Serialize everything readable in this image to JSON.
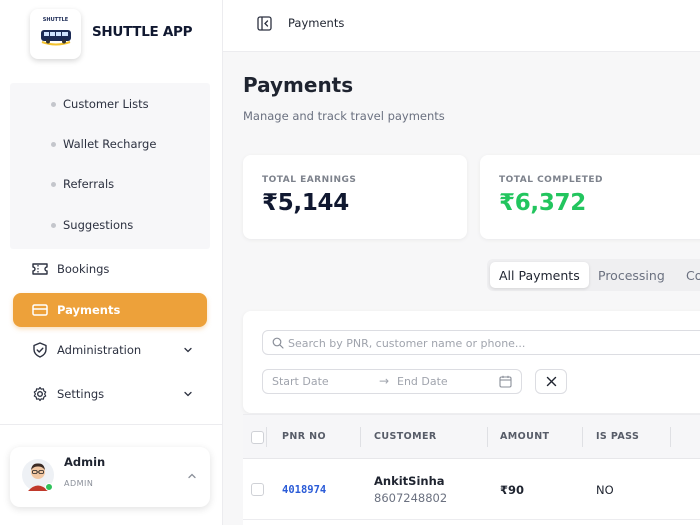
{
  "brand": {
    "name": "SHUTTLE APP",
    "logo_text": "SHUTTLE",
    "logo_bus_color": "#1b2a55",
    "logo_accent_color": "#f2c230"
  },
  "sidebar": {
    "submenu": [
      {
        "label": "Customer Lists"
      },
      {
        "label": "Wallet Recharge"
      },
      {
        "label": "Referrals"
      },
      {
        "label": "Suggestions"
      }
    ],
    "nav": {
      "bookings": {
        "label": "Bookings",
        "icon": "ticket-icon"
      },
      "payments": {
        "label": "Payments",
        "icon": "card-icon",
        "active": true
      },
      "administration": {
        "label": "Administration",
        "icon": "shield-icon"
      },
      "settings": {
        "label": "Settings",
        "icon": "gear-icon"
      }
    },
    "user": {
      "name": "Admin",
      "role": "ADMIN",
      "status_color": "#2fc25b"
    }
  },
  "topbar": {
    "breadcrumb": "Payments"
  },
  "page": {
    "title": "Payments",
    "subtitle": "Manage and track travel payments"
  },
  "stats": [
    {
      "label": "TOTAL EARNINGS",
      "value": "₹5,144",
      "color": "#101830"
    },
    {
      "label": "TOTAL COMPLETED",
      "value": "₹6,372",
      "color": "#22c55e"
    }
  ],
  "tabs": [
    {
      "label": "All Payments",
      "active": true
    },
    {
      "label": "Processing",
      "active": false
    },
    {
      "label": "Co",
      "active": false
    }
  ],
  "filters": {
    "search_placeholder": "Search by PNR, customer name or phone...",
    "start_date_placeholder": "Start Date",
    "end_date_placeholder": "End Date",
    "arrow": "→"
  },
  "table": {
    "columns": [
      "PNR NO",
      "CUSTOMER",
      "AMOUNT",
      "IS PASS"
    ],
    "rows": [
      {
        "pnr": "4018974",
        "customer_name": "AnkitSinha",
        "customer_phone": "8607248802",
        "amount": "₹90",
        "is_pass": "NO"
      }
    ]
  },
  "colors": {
    "accent": "#eda13a",
    "link": "#2a5bd7"
  }
}
